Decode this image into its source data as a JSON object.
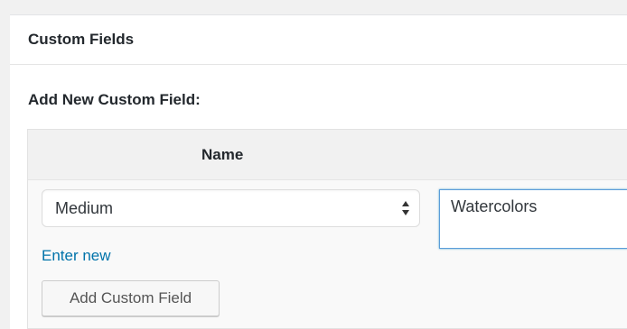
{
  "metabox": {
    "title": "Custom Fields"
  },
  "form": {
    "section_label": "Add New Custom Field:",
    "table": {
      "name_header": "Name"
    },
    "key_select": {
      "selected": "Medium"
    },
    "value_input": {
      "value": "Watercolors"
    },
    "enter_new_link": "Enter new",
    "add_button": "Add Custom Field"
  },
  "colors": {
    "link": "#0073aa",
    "focus_border": "#5b9dd9"
  },
  "icons": {
    "select_arrows": "updown-arrows-icon"
  }
}
